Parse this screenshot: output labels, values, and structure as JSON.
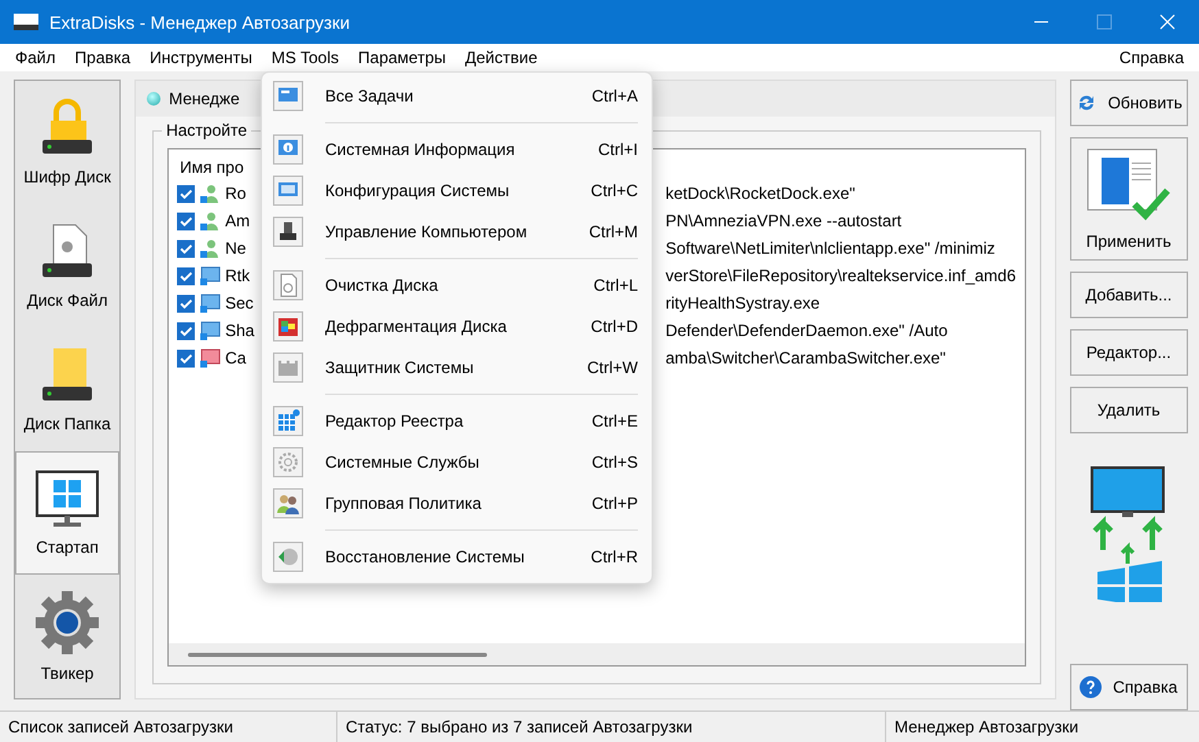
{
  "window": {
    "title": "ExtraDisks - Менеджер Автозагрузки"
  },
  "menu_bar": [
    {
      "label": "Файл"
    },
    {
      "label": "Правка"
    },
    {
      "label": "Инструменты"
    },
    {
      "label": "MS Tools"
    },
    {
      "label": "Параметры"
    },
    {
      "label": "Действие"
    },
    {
      "label": "Справка"
    }
  ],
  "sidebar": {
    "items": [
      {
        "label": "Шифр Диск",
        "kind": "lock",
        "selected": false
      },
      {
        "label": "Диск Файл",
        "kind": "file",
        "selected": false
      },
      {
        "label": "Диск Папка",
        "kind": "folder",
        "selected": false
      },
      {
        "label": "Стартап",
        "kind": "monitor",
        "selected": true
      },
      {
        "label": "Твикер",
        "kind": "gear",
        "selected": false
      }
    ]
  },
  "tab": {
    "label": "Менедже"
  },
  "group": {
    "label": "Настройте"
  },
  "list": {
    "column_1": "Имя про",
    "rows": [
      {
        "name": "Ro",
        "command": "ketDock\\RocketDock.exe\"",
        "checked": true,
        "kind": "user"
      },
      {
        "name": "Am",
        "command": "PN\\AmneziaVPN.exe --autostart",
        "checked": true,
        "kind": "user"
      },
      {
        "name": "Ne",
        "command": " Software\\NetLimiter\\nlclientapp.exe\" /minimiz",
        "checked": true,
        "kind": "user"
      },
      {
        "name": "Rtk",
        "command": "verStore\\FileRepository\\realtekservice.inf_amd6",
        "checked": true,
        "kind": "system"
      },
      {
        "name": "Sec",
        "command": "rityHealthSystray.exe",
        "checked": true,
        "kind": "system"
      },
      {
        "name": "Sha",
        "command": "Defender\\DefenderDaemon.exe\" /Auto",
        "checked": true,
        "kind": "system"
      },
      {
        "name": "Ca",
        "command": "amba\\Switcher\\CarambaSwitcher.exe\"",
        "checked": true,
        "kind": "app"
      }
    ]
  },
  "dropdown_menu": {
    "groups": [
      {
        "items": [
          {
            "label": "Все Задачи",
            "shortcut": "Ctrl+A"
          }
        ]
      },
      {
        "items": [
          {
            "label": "Системная Информация",
            "shortcut": "Ctrl+I"
          },
          {
            "label": "Конфигурация Системы",
            "shortcut": "Ctrl+C"
          },
          {
            "label": "Управление Компьютером",
            "shortcut": "Ctrl+M"
          }
        ]
      },
      {
        "items": [
          {
            "label": "Очистка Диска",
            "shortcut": "Ctrl+L"
          },
          {
            "label": "Дефрагментация Диска",
            "shortcut": "Ctrl+D"
          },
          {
            "label": "Защитник Системы",
            "shortcut": "Ctrl+W"
          }
        ]
      },
      {
        "items": [
          {
            "label": "Редактор Реестра",
            "shortcut": "Ctrl+E"
          },
          {
            "label": "Системные Службы",
            "shortcut": "Ctrl+S"
          },
          {
            "label": "Групповая Политика",
            "shortcut": "Ctrl+P"
          }
        ]
      },
      {
        "items": [
          {
            "label": "Восстановление Системы",
            "shortcut": "Ctrl+R"
          }
        ]
      }
    ]
  },
  "buttons": [
    {
      "label": "Обновить",
      "kind": "refresh"
    },
    {
      "label": "Применить",
      "kind": "apply"
    },
    {
      "label": "Добавить...",
      "kind": "plain"
    },
    {
      "label": "Редактор...",
      "kind": "plain"
    },
    {
      "label": "Удалить",
      "kind": "plain"
    }
  ],
  "help_button": {
    "label": "Справка"
  },
  "status_bar": [
    "Список записей Автозагрузки",
    "Статус: 7 выбрано из 7 записей Автозагрузки",
    "Менеджер Автозагрузки"
  ]
}
